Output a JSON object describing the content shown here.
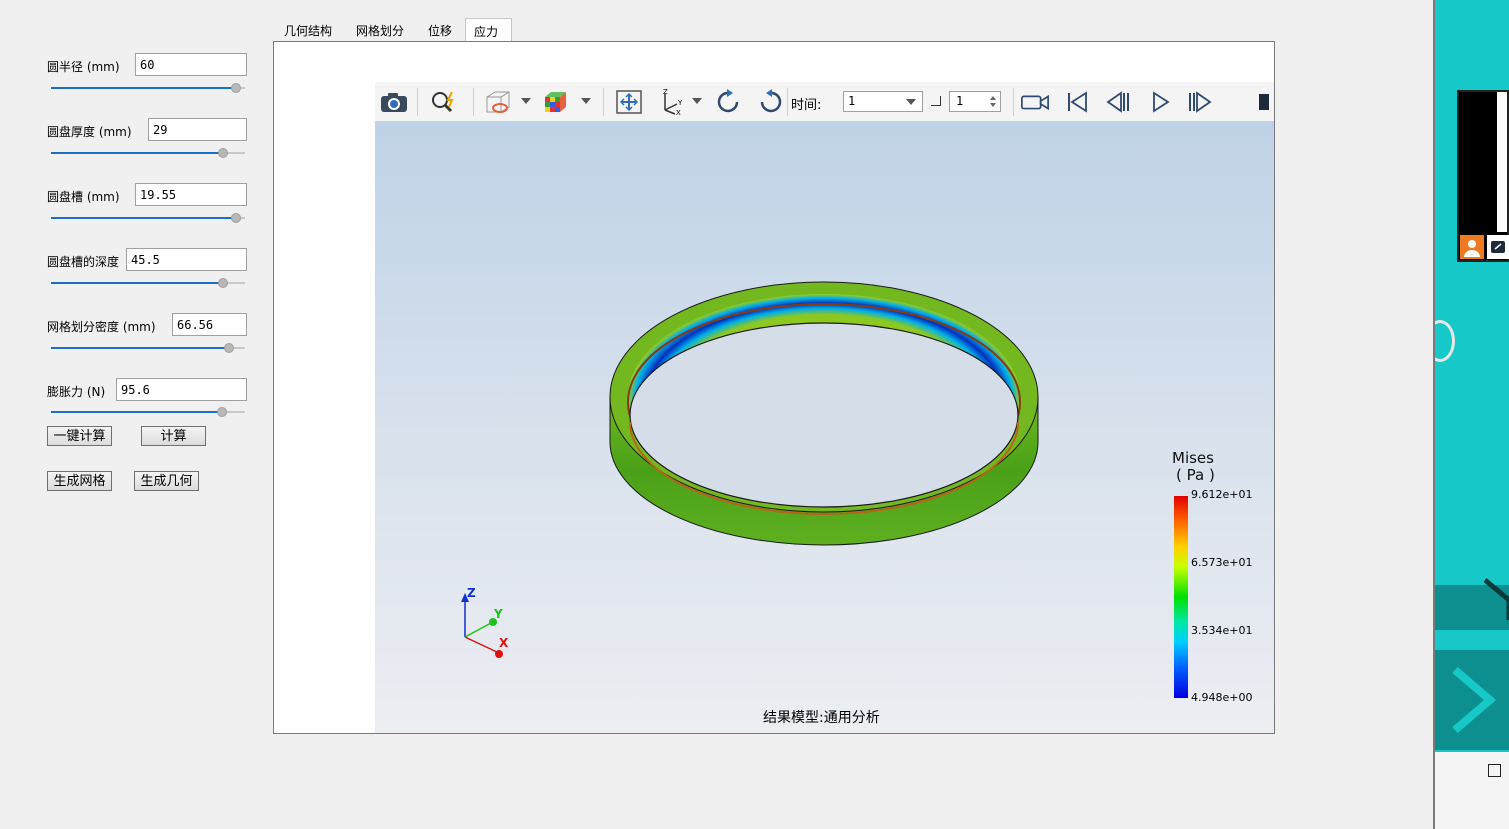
{
  "tabs": [
    {
      "label": "几何结构"
    },
    {
      "label": "网格划分"
    },
    {
      "label": "位移"
    },
    {
      "label": "应力"
    }
  ],
  "params": [
    {
      "label": "圆半径 (mm)",
      "value": "60",
      "slider_fraction": 0.98
    },
    {
      "label": "圆盘厚度 (mm)",
      "value": "29",
      "slider_fraction": 0.91
    },
    {
      "label": "圆盘槽 (mm)",
      "value": "19.55",
      "slider_fraction": 0.98
    },
    {
      "label": "圆盘槽的深度",
      "value": "45.5",
      "slider_fraction": 0.91
    },
    {
      "label": "网格划分密度 (mm)",
      "value": "66.56",
      "slider_fraction": 0.94
    },
    {
      "label": "膨胀力 (N)",
      "value": "95.6",
      "slider_fraction": 0.9
    }
  ],
  "buttons": {
    "one_click_calc": "一键计算",
    "calc": "计算",
    "gen_mesh": "生成网格",
    "gen_geometry": "生成几何"
  },
  "toolbar": {
    "time_label": "时间:",
    "time_value": "1",
    "step_value": "1",
    "icons": [
      "camera-icon",
      "zoom-icon",
      "display-mode-icon",
      "color-cube-icon",
      "fit-view-icon",
      "axis-orient-icon",
      "rotate-cw-icon",
      "rotate-ccw-icon",
      "record-icon",
      "first-frame-icon",
      "prev-frame-icon",
      "play-icon",
      "next-frame-icon"
    ]
  },
  "viewer": {
    "model_label": "结果模型:通用分析",
    "legend": {
      "title_line1": "Mises",
      "title_line2": "( Pa )",
      "values": [
        "9.612e+01",
        "6.573e+01",
        "3.534e+01",
        "4.948e+00"
      ]
    },
    "triad": {
      "x": "X",
      "y": "Y",
      "z": "Z"
    }
  },
  "colors": {
    "slider_track": "#1a6fc4",
    "right_panel": "#16c8c8"
  }
}
